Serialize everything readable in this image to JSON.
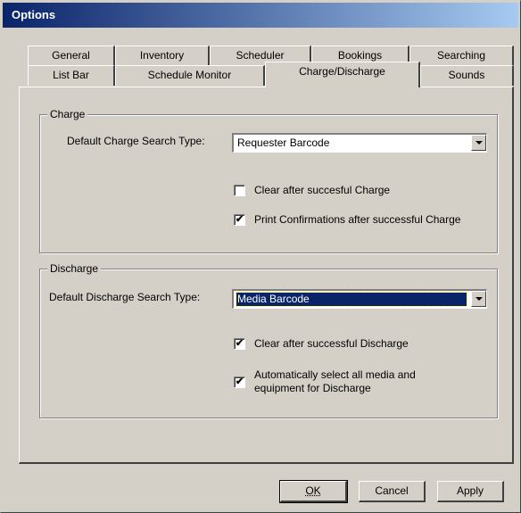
{
  "window": {
    "title": "Options"
  },
  "tabs": {
    "row1": [
      "General",
      "Inventory",
      "Scheduler",
      "Bookings",
      "Searching"
    ],
    "row2": [
      "List Bar",
      "Schedule Monitor",
      "Charge/Discharge",
      "Sounds"
    ],
    "active": "Charge/Discharge"
  },
  "charge": {
    "group_label": "Charge",
    "search_type_label": "Default Charge Search Type:",
    "search_type_value": "Requester Barcode",
    "clear_label": "Clear after succesful Charge",
    "clear_checked": false,
    "print_label": "Print Confirmations after successful Charge",
    "print_checked": true
  },
  "discharge": {
    "group_label": "Discharge",
    "search_type_label": "Default Discharge Search Type:",
    "search_type_value": "Media Barcode",
    "clear_label": "Clear after successful Discharge",
    "clear_checked": true,
    "auto_select_label_line1": "Automatically select all media and",
    "auto_select_label_line2": "equipment for Discharge",
    "auto_select_checked": true
  },
  "buttons": {
    "ok": "OK",
    "cancel": "Cancel",
    "apply": "Apply"
  },
  "colors": {
    "titlebar_start": "#0a246a",
    "titlebar_end": "#a6caf0",
    "face": "#d4d0c8"
  }
}
